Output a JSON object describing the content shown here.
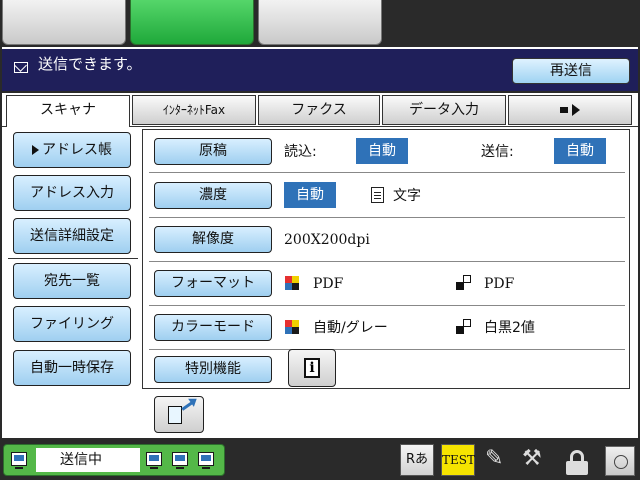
{
  "message": {
    "text": "送信できます。",
    "resend_button": "再送信"
  },
  "tabs": [
    {
      "label": "スキャナ",
      "active": true
    },
    {
      "label": "ｲﾝﾀｰﾈｯﾄFax",
      "active": false
    },
    {
      "label": "ファクス",
      "active": false
    },
    {
      "label": "データ入力",
      "active": false
    }
  ],
  "nav": {
    "address_book": "アドレス帳",
    "address_input": "アドレス入力",
    "send_settings": "送信詳細設定",
    "destination_list": "宛先一覧",
    "filing": "ファイリング",
    "auto_temp_save": "自動一時保存"
  },
  "settings": {
    "original": {
      "button": "原稿",
      "read_label": "読込:",
      "read_value": "自動",
      "send_label": "送信:",
      "send_value": "自動"
    },
    "density": {
      "button": "濃度",
      "value": "自動",
      "mode": "文字"
    },
    "resolution": {
      "button": "解像度",
      "value": "200X200dpi"
    },
    "format": {
      "button": "フォーマット",
      "color_value": "PDF",
      "bw_value": "PDF"
    },
    "color_mode": {
      "button": "カラーモード",
      "color_value": "自動/グレー",
      "bw_value": "白黒2値"
    },
    "special": {
      "button": "特別機能"
    }
  },
  "status": {
    "job_text": "送信中",
    "input_mode": "Rあ",
    "test": "TEST"
  },
  "colors": {
    "accent_blue": "#2f72b8",
    "button_light": "#9fcff0",
    "message_bar": "#1f1f5a",
    "active_mode": "#1fa83a"
  }
}
